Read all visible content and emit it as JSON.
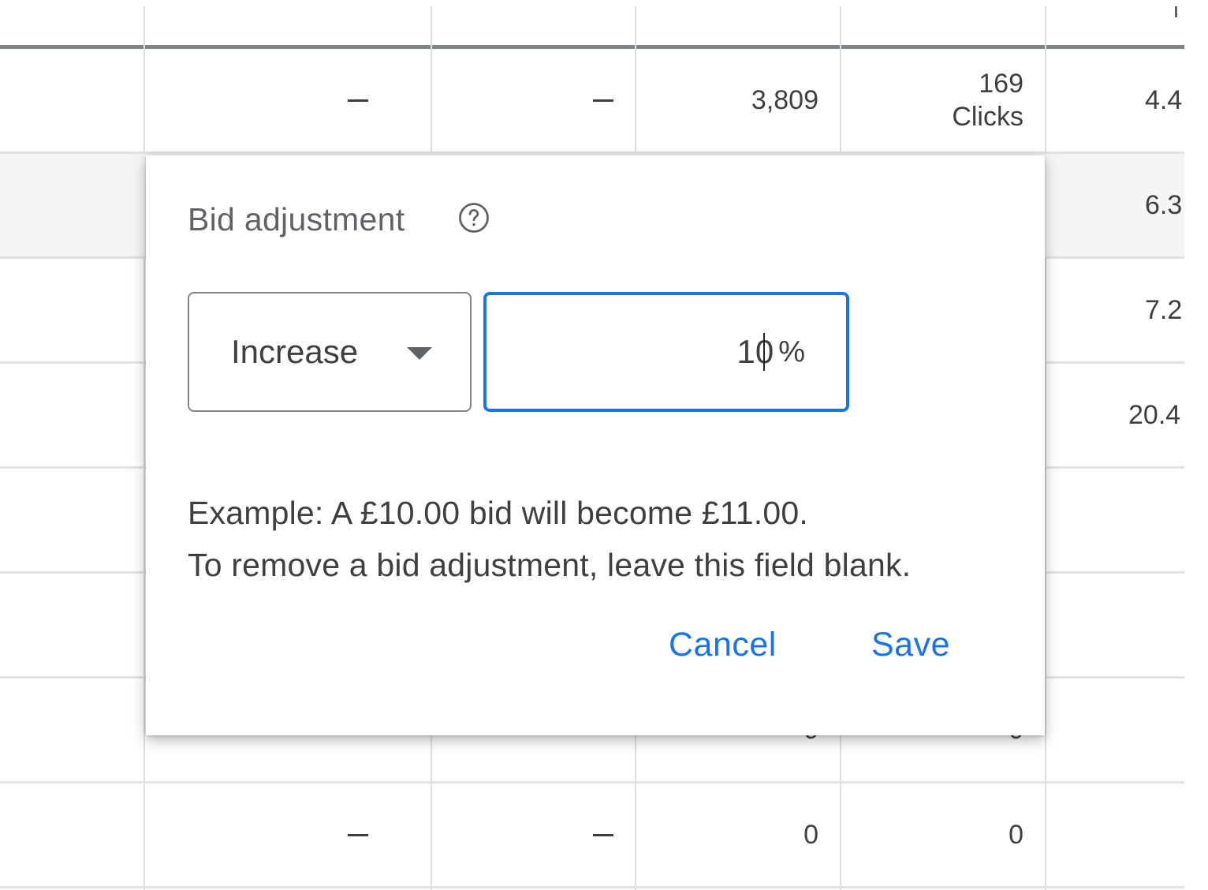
{
  "table": {
    "rows": [
      {
        "c1": "—",
        "c2": "—",
        "c3": "3,809",
        "c4_value": "169",
        "c4_unit": "Clicks",
        "c5": "4.4",
        "hover": false
      },
      {
        "c1": "",
        "c2": "",
        "c3": "",
        "c4_value": "",
        "c4_unit": "",
        "c5": "6.3",
        "hover": true
      },
      {
        "c1": "",
        "c2": "",
        "c3": "",
        "c4_value": "",
        "c4_unit": "",
        "c5": "7.2",
        "hover": false
      },
      {
        "c1": "",
        "c2": "",
        "c3": "",
        "c4_value": "",
        "c4_unit": "",
        "c5": "20.4",
        "hover": false
      },
      {
        "c1": "",
        "c2": "",
        "c3": "",
        "c4_value": "",
        "c4_unit": "",
        "c5": "",
        "hover": false
      },
      {
        "c1": "",
        "c2": "",
        "c3": "",
        "c4_value": "",
        "c4_unit": "",
        "c5": "",
        "hover": false
      },
      {
        "c1": "",
        "c2": "",
        "c3": "0",
        "c4_value": "0",
        "c4_unit": "",
        "c5": "",
        "hover": false
      },
      {
        "c1": "—",
        "c2": "—",
        "c3": "0",
        "c4_value": "0",
        "c4_unit": "",
        "c5": "",
        "hover": false
      }
    ]
  },
  "dialog": {
    "title": "Bid adjustment",
    "help_icon": "help-circle-icon",
    "direction_select": {
      "selected": "Increase"
    },
    "percent_input": {
      "value": "10",
      "suffix": "%"
    },
    "example_text": "Example: A £10.00 bid will become £11.00.",
    "remove_hint": "To remove a bid adjustment, leave this field blank.",
    "cancel_label": "Cancel",
    "save_label": "Save",
    "accent_color": "#1a73e8"
  }
}
